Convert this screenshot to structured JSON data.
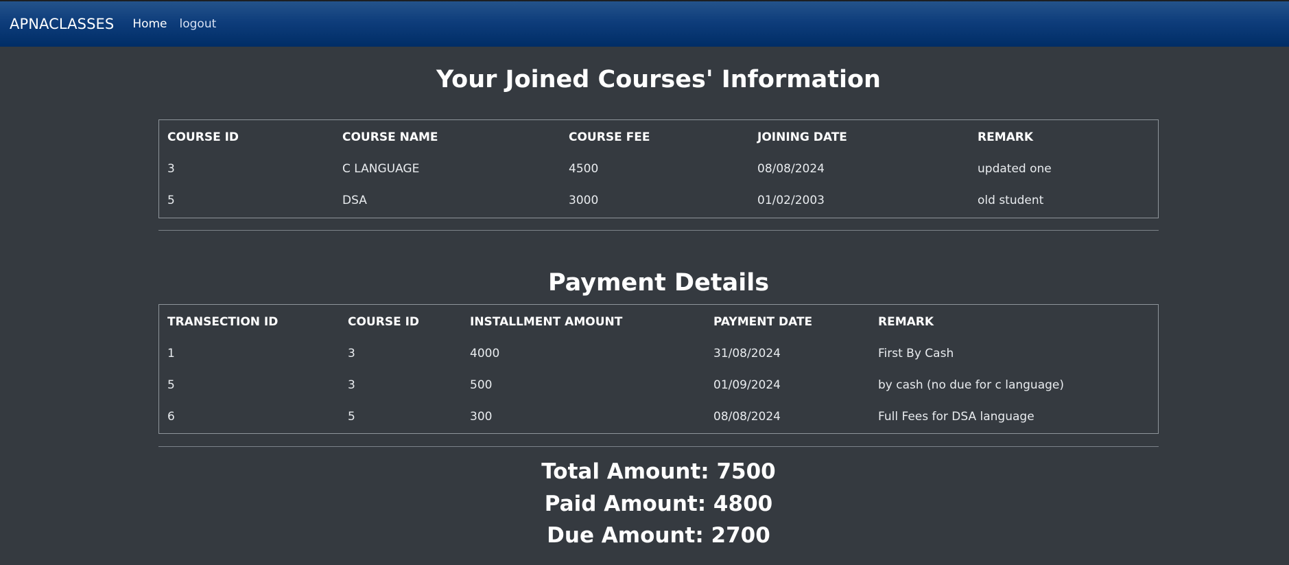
{
  "navbar": {
    "brand": "APNACLASSES",
    "links": [
      {
        "label": "Home"
      },
      {
        "label": "logout"
      }
    ]
  },
  "courses": {
    "title": "Your Joined Courses' Information",
    "headers": [
      "COURSE ID",
      "COURSE NAME",
      "COURSE FEE",
      "JOINING DATE",
      "REMARK"
    ],
    "rows": [
      [
        "3",
        "C LANGUAGE",
        "4500",
        "08/08/2024",
        "updated one"
      ],
      [
        "5",
        "DSA",
        "3000",
        "01/02/2003",
        "old student"
      ]
    ]
  },
  "payments": {
    "title": "Payment Details",
    "headers": [
      "TRANSECTION ID",
      "COURSE ID",
      "INSTALLMENT AMOUNT",
      "PAYMENT DATE",
      "REMARK"
    ],
    "rows": [
      [
        "1",
        "3",
        "4000",
        "31/08/2024",
        "First By Cash"
      ],
      [
        "5",
        "3",
        "500",
        "01/09/2024",
        "by cash (no due for c language)"
      ],
      [
        "6",
        "5",
        "300",
        "08/08/2024",
        "Full Fees for DSA language"
      ]
    ]
  },
  "summary": {
    "total": "Total Amount: 7500",
    "paid": "Paid Amount: 4800",
    "due": "Due Amount: 2700"
  },
  "colors": {
    "background": "#353a40",
    "navbar": "#0e3d7b",
    "text": "#ffffff"
  }
}
